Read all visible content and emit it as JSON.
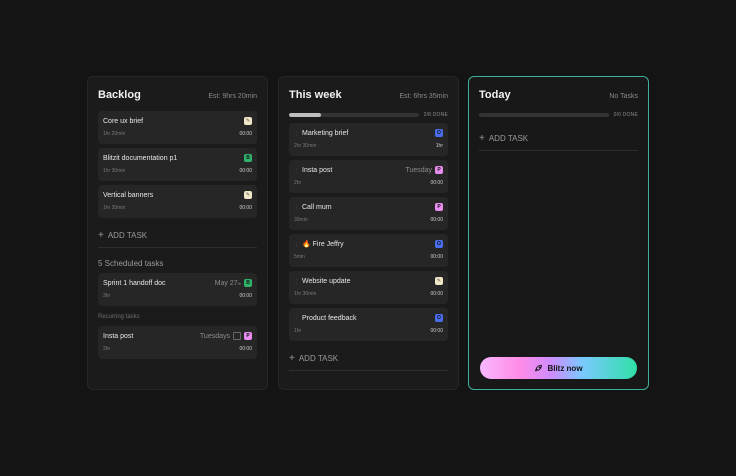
{
  "backlog": {
    "title": "Backlog",
    "estimate": "Est: 9hrs 20min",
    "cards": [
      {
        "title": "Core ux brief",
        "duration": "1hr 20min",
        "time": "00:00",
        "tag": "",
        "tag_color": "#f1e7c8"
      },
      {
        "title": "Blitzit documentation p1",
        "duration": "1hr 30min",
        "time": "00:00",
        "tag": "B",
        "tag_color": "#2fb36b"
      },
      {
        "title": "Vertical banners",
        "duration": "1hr 30min",
        "time": "00:00",
        "tag": "",
        "tag_color": "#f1e7c8"
      }
    ],
    "add_task": "ADD TASK",
    "scheduled_label": "5 Scheduled tasks",
    "scheduled": [
      {
        "title": "Sprint 1 handoff doc",
        "due": "May 27",
        "due_sup": "th",
        "duration": "3hr",
        "time": "00:00",
        "tag": "B",
        "tag_color": "#2fb36b"
      }
    ],
    "recurring_label": "Recurring tasks",
    "recurring": [
      {
        "title": "Insta post",
        "repeat": "Tuesdays",
        "duration": "2hr",
        "time": "00:00",
        "tag": "P",
        "tag_color": "#e98ef0"
      }
    ]
  },
  "week": {
    "title": "This week",
    "estimate": "Est: 6hrs 35min",
    "progress": 0.25,
    "done_label": "2/8 DONE",
    "cards": [
      {
        "title": "Marketing brief",
        "duration": "2hr 30min",
        "time": "1hr",
        "tag": "O",
        "tag_color": "#4a6ef0",
        "when": ""
      },
      {
        "title": "Insta post",
        "duration": "2hr",
        "time": "00:00",
        "tag": "P",
        "tag_color": "#e98ef0",
        "when": "Tuesday"
      },
      {
        "title": "Call mum",
        "duration": "30min",
        "time": "00:00",
        "tag": "P",
        "tag_color": "#e98ef0",
        "when": ""
      },
      {
        "title": "🔥 Fire Jeffry",
        "duration": "5min",
        "time": "00:00",
        "tag": "O",
        "tag_color": "#4a6ef0",
        "when": ""
      },
      {
        "title": "Website update",
        "duration": "1hr 30min",
        "time": "00:00",
        "tag": "",
        "tag_color": "#f1e7c8",
        "when": ""
      },
      {
        "title": "Product feedback",
        "duration": "1hr",
        "time": "00:00",
        "tag": "O",
        "tag_color": "#4a6ef0",
        "when": ""
      }
    ],
    "add_task": "ADD TASK"
  },
  "today": {
    "title": "Today",
    "status": "No Tasks",
    "progress": 0,
    "done_label": "0/0 DONE",
    "add_task": "ADD TASK",
    "blitz_label": "Blitz now"
  }
}
